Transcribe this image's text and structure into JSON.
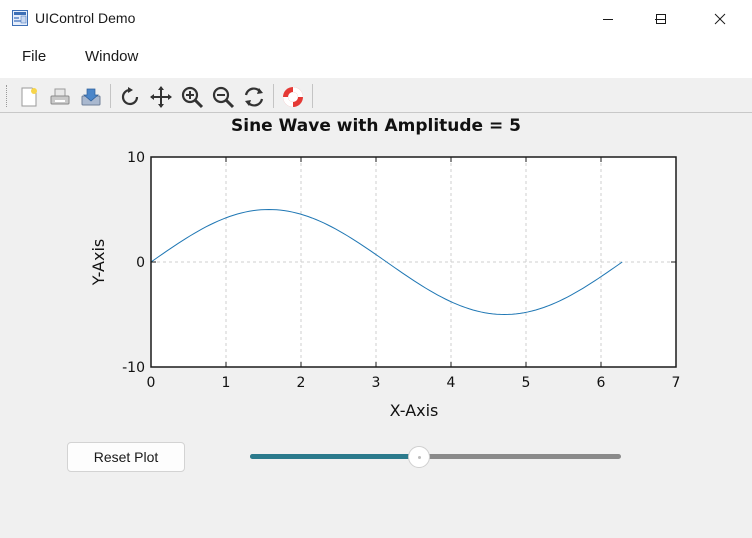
{
  "window": {
    "title": "UIControl Demo",
    "controls": [
      "minimize-icon",
      "maximize-icon",
      "close-icon"
    ]
  },
  "menubar": {
    "items": [
      {
        "label": "File"
      },
      {
        "label": "Window"
      }
    ]
  },
  "toolbar": {
    "tools": [
      "new-figure-icon",
      "print-icon",
      "save-icon",
      "rotate-icon",
      "pan-icon",
      "zoom-in-icon",
      "zoom-out-icon",
      "refresh-icon",
      "help-icon"
    ]
  },
  "chart_data": {
    "type": "line",
    "title": "Sine Wave with Amplitude = 5",
    "xlabel": "X-Axis",
    "ylabel": "Y-Axis",
    "xlim": [
      0,
      7
    ],
    "ylim": [
      -10,
      10
    ],
    "xticks": [
      0,
      1,
      2,
      3,
      4,
      5,
      6,
      7
    ],
    "yticks": [
      -10,
      0,
      10
    ],
    "grid": true,
    "series": [
      {
        "color": "#1f77b4",
        "function": "5*sin(x)",
        "x_range": [
          0,
          6.283
        ],
        "amplitude": 5
      }
    ]
  },
  "controls": {
    "reset_label": "Reset Plot",
    "slider": {
      "value": 5,
      "min": 0,
      "max": 11,
      "fill_color": "#2b7a8c",
      "track_color": "#8a8a8a"
    }
  }
}
